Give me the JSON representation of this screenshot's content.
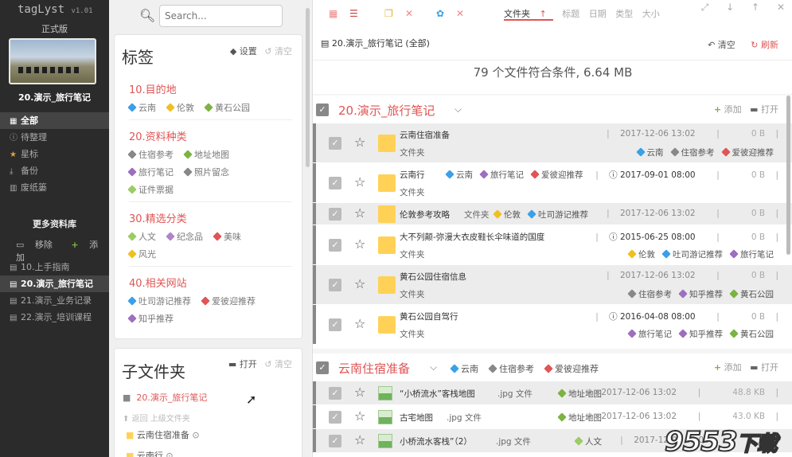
{
  "app": {
    "name": "tagLyst",
    "version": "v1.01",
    "edition": "正式版",
    "current_library": "20.演示_旅行笔记"
  },
  "nav": [
    {
      "icon": "grid-icon",
      "label": "全部"
    },
    {
      "icon": "info-icon",
      "label": "待整理"
    },
    {
      "icon": "star-icon",
      "label": "星标"
    },
    {
      "icon": "download-icon",
      "label": "备份"
    },
    {
      "icon": "trash-icon",
      "label": "废纸篓"
    }
  ],
  "libraries": {
    "title": "更多资料库",
    "remove_label": "移除",
    "add_label": "添加",
    "items": [
      "10.上手指南",
      "20.演示_旅行笔记",
      "21.演示_业务记录",
      "22.演示_培训课程"
    ]
  },
  "search": {
    "placeholder": "Search..."
  },
  "tags_panel": {
    "title": "标签",
    "settings_label": "设置",
    "clear_label": "清空",
    "groups": [
      {
        "title": "10.目的地",
        "tags": [
          {
            "label": "云南",
            "color": "#3aa0e8"
          },
          {
            "label": "伦敦",
            "color": "#f0c020"
          },
          {
            "label": "黄石公园",
            "color": "#7cb342"
          }
        ]
      },
      {
        "title": "20.资料种类",
        "tags": [
          {
            "label": "住宿参考",
            "color": "#888888"
          },
          {
            "label": "地址地图",
            "color": "#7cb342"
          },
          {
            "label": "旅行笔记",
            "color": "#9c6fbf"
          },
          {
            "label": "照片留念",
            "color": "#888888"
          },
          {
            "label": "证件票据",
            "color": "#9ccc65"
          }
        ]
      },
      {
        "title": "30.精选分类",
        "tags": [
          {
            "label": "人文",
            "color": "#9ccc65"
          },
          {
            "label": "纪念品",
            "color": "#b084c9"
          },
          {
            "label": "美味",
            "color": "#e05555"
          },
          {
            "label": "风光",
            "color": "#f0c020"
          }
        ]
      },
      {
        "title": "40.相关网站",
        "tags": [
          {
            "label": "吐司游记推荐",
            "color": "#3aa0e8"
          },
          {
            "label": "爱彼迎推荐",
            "color": "#e05555"
          },
          {
            "label": "知乎推荐",
            "color": "#9c6fbf"
          }
        ]
      }
    ]
  },
  "subfolder_panel": {
    "title": "子文件夹",
    "open_label": "打开",
    "clear_label": "清空",
    "current": "20.演示_旅行笔记",
    "back_label": "返回 上级文件夹",
    "items": [
      "云南住宿准备",
      "云南行"
    ]
  },
  "sort": {
    "options": [
      "文件夹",
      "标题",
      "日期",
      "类型",
      "大小"
    ],
    "active": "文件夹",
    "arrow": "↑"
  },
  "path": {
    "label": "20.演示_旅行笔记 (全部)",
    "clear_label": "清空",
    "refresh_label": "刷新"
  },
  "summary": "79 个文件符合条件, 6.64 MB",
  "sections": [
    {
      "title": "20.演示_旅行笔记",
      "add_label": "添加",
      "open_label": "打开",
      "rows": [
        {
          "name": "云南住宿准备",
          "type": "文件夹",
          "date": "2017-12-06 13:02",
          "size": "0 B",
          "tags": [
            {
              "label": "云南",
              "color": "#3aa0e8"
            },
            {
              "label": "住宿参考",
              "color": "#888888"
            },
            {
              "label": "爱彼迎推荐",
              "color": "#e05555"
            }
          ]
        },
        {
          "name": "云南行",
          "type": "文件夹",
          "date": "2017-09-01 08:00",
          "size": "0 B",
          "tags": [
            {
              "label": "云南",
              "color": "#3aa0e8"
            },
            {
              "label": "旅行笔记",
              "color": "#9c6fbf"
            },
            {
              "label": "爱彼迎推荐",
              "color": "#e05555"
            }
          ]
        },
        {
          "name": "伦敦参考攻略",
          "type": "文件夹",
          "date": "2017-12-06 13:02",
          "size": "0 B",
          "tags": [
            {
              "label": "伦敦",
              "color": "#f0c020"
            },
            {
              "label": "吐司游记推荐",
              "color": "#3aa0e8"
            }
          ]
        },
        {
          "name": "大不列颠-弥漫大衣皮鞋长伞味道的国度",
          "type": "文件夹",
          "date": "2015-06-25 08:00",
          "size": "0 B",
          "tags": [
            {
              "label": "伦敦",
              "color": "#f0c020"
            },
            {
              "label": "吐司游记推荐",
              "color": "#3aa0e8"
            },
            {
              "label": "旅行笔记",
              "color": "#9c6fbf"
            }
          ]
        },
        {
          "name": "黄石公园住宿信息",
          "type": "文件夹",
          "date": "2017-12-06 13:02",
          "size": "0 B",
          "tags": [
            {
              "label": "住宿参考",
              "color": "#888888"
            },
            {
              "label": "知乎推荐",
              "color": "#9c6fbf"
            },
            {
              "label": "黄石公园",
              "color": "#7cb342"
            }
          ]
        },
        {
          "name": "黄石公园自驾行",
          "type": "文件夹",
          "date": "2016-04-08 08:00",
          "size": "0 B",
          "tags": [
            {
              "label": "旅行笔记",
              "color": "#9c6fbf"
            },
            {
              "label": "知乎推荐",
              "color": "#9c6fbf"
            },
            {
              "label": "黄石公园",
              "color": "#7cb342"
            }
          ]
        }
      ]
    },
    {
      "title": "云南住宿准备",
      "add_label": "添加",
      "open_label": "打开",
      "tags": [
        {
          "label": "云南",
          "color": "#3aa0e8"
        },
        {
          "label": "住宿参考",
          "color": "#888888"
        },
        {
          "label": "爱彼迎推荐",
          "color": "#e05555"
        }
      ],
      "rows": [
        {
          "name": "“小桥流水”客栈地图",
          "type": ".jpg 文件",
          "date": "2017-12-06 13:02",
          "size": "48.8 KB",
          "tags": [
            {
              "label": "地址地图",
              "color": "#7cb342"
            }
          ]
        },
        {
          "name": "古宅地图",
          "type": ".jpg 文件",
          "date": "2017-12-06 13:02",
          "size": "43.0 KB",
          "tags": [
            {
              "label": "地址地图",
              "color": "#7cb342"
            }
          ]
        },
        {
          "name": "小桥流水客栈”（2）",
          "type": ".jpg 文件",
          "date": "2017-12-06 13:02",
          "size": "",
          "tags": [
            {
              "label": "人文",
              "color": "#9ccc65"
            }
          ]
        }
      ]
    }
  ],
  "watermark": {
    "text": "9553",
    "suffix": "下载"
  }
}
